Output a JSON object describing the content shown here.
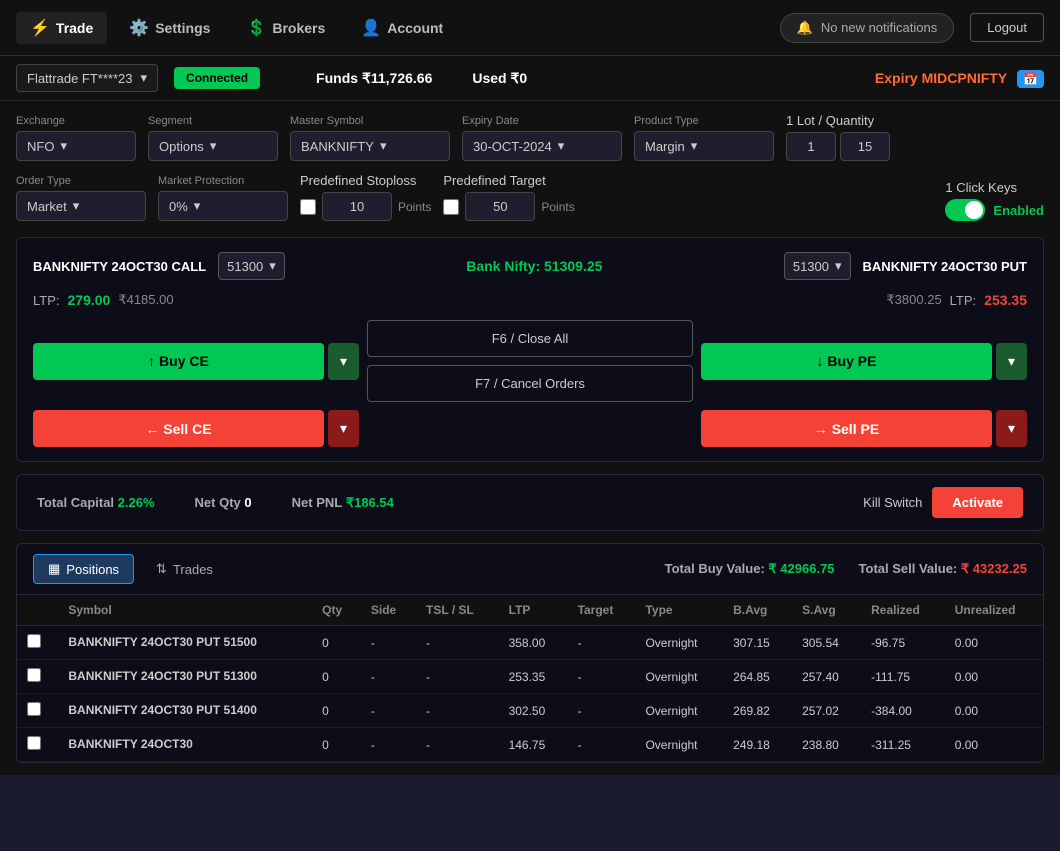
{
  "topbar": {
    "trade_label": "Trade",
    "settings_label": "Settings",
    "brokers_label": "Brokers",
    "account_label": "Account",
    "notifications_label": "No new notifications",
    "logout_label": "Logout"
  },
  "subbar": {
    "broker": "Flattrade FT****23",
    "connected": "Connected",
    "funds_label": "Funds",
    "funds_value": "₹11,726.66",
    "used_label": "Used",
    "used_value": "₹0",
    "expiry_label": "Expiry",
    "expiry_value": "MIDCPNIFTY"
  },
  "form": {
    "exchange_label": "Exchange",
    "exchange_value": "NFO",
    "segment_label": "Segment",
    "segment_value": "Options",
    "master_symbol_label": "Master Symbol",
    "master_symbol_value": "BANKNIFTY",
    "expiry_date_label": "Expiry Date",
    "expiry_date_value": "30-OCT-2024",
    "product_type_label": "Product Type",
    "product_type_value": "Margin",
    "lot_qty_label": "1 Lot / Quantity",
    "lot_value": "1",
    "qty_value": "15",
    "order_type_label": "Order Type",
    "order_type_value": "Market",
    "market_protection_label": "Market Protection",
    "market_protection_value": "0%",
    "predefined_sl_label": "Predefined Stoploss",
    "sl_value": "10",
    "sl_unit": "Points",
    "predefined_target_label": "Predefined Target",
    "target_value": "50",
    "target_unit": "Points",
    "click_keys_label": "1 Click Keys",
    "enabled_label": "Enabled"
  },
  "trading": {
    "call_symbol": "BANKNIFTY 24OCT30 CALL",
    "call_strike": "51300",
    "bank_nifty_label": "Bank Nifty:",
    "bank_nifty_value": "51309.25",
    "put_strike": "51300",
    "put_symbol": "BANKNIFTY 24OCT30 PUT",
    "call_ltp_label": "LTP:",
    "call_ltp_value": "279.00",
    "call_price_right": "₹4185.00",
    "put_price_left": "₹3800.25",
    "put_ltp_label": "LTP:",
    "put_ltp_value": "253.35",
    "buy_ce_label": "Buy CE",
    "sell_ce_label": "Sell CE",
    "f6_label": "F6 / Close All",
    "f7_label": "F7 / Cancel Orders",
    "buy_pe_label": "Buy PE",
    "sell_pe_label": "Sell PE"
  },
  "pnl_bar": {
    "total_capital_label": "Total Capital",
    "total_capital_value": "2.26%",
    "net_qty_label": "Net Qty",
    "net_qty_value": "0",
    "net_pnl_label": "Net PNL",
    "net_pnl_value": "₹186.54",
    "kill_switch_label": "Kill Switch",
    "activate_label": "Activate"
  },
  "positions": {
    "positions_tab": "Positions",
    "trades_tab": "Trades",
    "total_buy_label": "Total Buy Value:",
    "total_buy_value": "₹ 42966.75",
    "total_sell_label": "Total Sell Value:",
    "total_sell_value": "₹ 43232.25",
    "columns": [
      "Select",
      "Symbol",
      "Qty",
      "Side",
      "TSL / SL",
      "LTP",
      "Target",
      "Type",
      "B.Avg",
      "S.Avg",
      "Realized",
      "Unrealized"
    ],
    "rows": [
      {
        "symbol": "BANKNIFTY 24OCT30 PUT 51500",
        "qty": "0",
        "side": "-",
        "tsl": "-",
        "ltp": "358.00",
        "target": "-",
        "type": "Overnight",
        "bavg": "307.15",
        "savg": "305.54",
        "realized": "-96.75",
        "unrealized": "0.00"
      },
      {
        "symbol": "BANKNIFTY 24OCT30 PUT 51300",
        "qty": "0",
        "side": "-",
        "tsl": "-",
        "ltp": "253.35",
        "target": "-",
        "type": "Overnight",
        "bavg": "264.85",
        "savg": "257.40",
        "realized": "-111.75",
        "unrealized": "0.00"
      },
      {
        "symbol": "BANKNIFTY 24OCT30 PUT 51400",
        "qty": "0",
        "side": "-",
        "tsl": "-",
        "ltp": "302.50",
        "target": "-",
        "type": "Overnight",
        "bavg": "269.82",
        "savg": "257.02",
        "realized": "-384.00",
        "unrealized": "0.00"
      },
      {
        "symbol": "BANKNIFTY 24OCT30",
        "qty": "0",
        "side": "-",
        "tsl": "-",
        "ltp": "146.75",
        "target": "-",
        "type": "Overnight",
        "bavg": "249.18",
        "savg": "238.80",
        "realized": "-311.25",
        "unrealized": "0.00"
      }
    ]
  }
}
